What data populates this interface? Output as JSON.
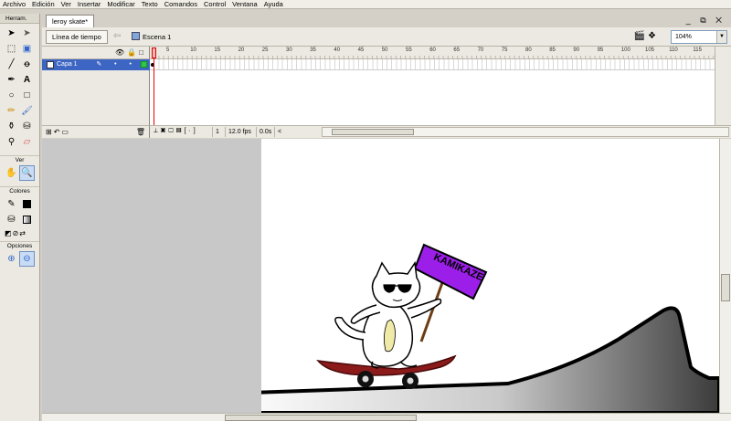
{
  "menu": [
    "Archivo",
    "Edición",
    "Ver",
    "Insertar",
    "Modificar",
    "Texto",
    "Comandos",
    "Control",
    "Ventana",
    "Ayuda"
  ],
  "tools": {
    "header": "Herram.",
    "view_label": "Ver",
    "colors_label": "Colores",
    "options_label": "Opciones"
  },
  "document": {
    "tab_title": "leroy skate*",
    "window_controls": "_ ⧉ ✕",
    "timeline_button": "Línea de tiempo",
    "scene_label": "Escena 1",
    "zoom_value": "104%"
  },
  "timeline": {
    "layer_name": "Capa 1",
    "frame_ticks": [
      "5",
      "10",
      "15",
      "20",
      "25",
      "30",
      "35",
      "40",
      "45",
      "50",
      "55",
      "60",
      "65",
      "70",
      "75",
      "80",
      "85",
      "90",
      "95",
      "100",
      "105",
      "110",
      "115"
    ],
    "current_frame": "1",
    "frame_rate": "12.0 fps",
    "elapsed_time": "0.0s"
  },
  "stage": {
    "sign_text": "KAMIKAZE"
  },
  "colors": {
    "sign_purple": "#9b1fe8",
    "skateboard_red": "#8b1a1a",
    "selected_layer": "#3d66c4"
  }
}
